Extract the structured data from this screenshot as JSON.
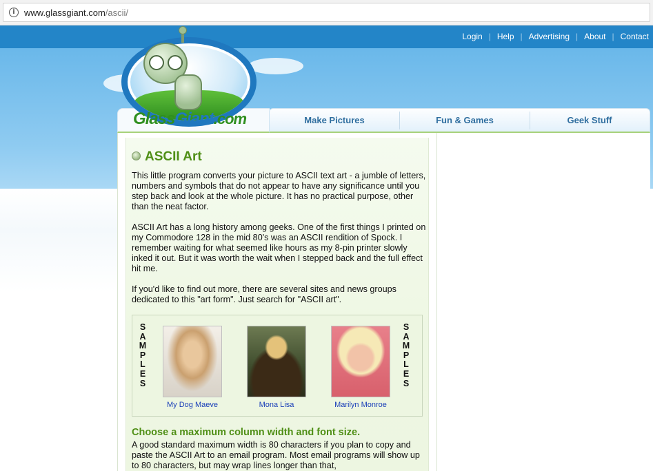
{
  "browser": {
    "url_domain": "www.glassgiant.com",
    "url_path": "/ascii/"
  },
  "top_links": [
    "Login",
    "Help",
    "Advertising",
    "About",
    "Contact"
  ],
  "logo": {
    "part1": "Glass",
    "part2": "Giant",
    "part3": ".com"
  },
  "main_nav": [
    "Make Pictures",
    "Fun & Games",
    "Geek Stuff"
  ],
  "content": {
    "title": "ASCII Art",
    "paragraphs": [
      "This little program converts your picture to ASCII text art - a jumble of letters, numbers and symbols that do not appear to have any significance until you step back and look at the whole picture. It has no practical purpose, other than the neat factor.",
      "ASCII Art has a long history among geeks. One of the first things I printed on my Commodore 128 in the mid 80's was an ASCII rendition of Spock. I remember waiting for what seemed like hours as my 8-pin printer slowly inked it out. But it was worth the wait when I stepped back and the full effect hit me.",
      "If you'd like to find out more, there are several sites and news groups dedicated to this \"art form\". Just search for \"ASCII art\"."
    ],
    "samples_vertical": "SAMPLES",
    "samples": [
      {
        "label": "My Dog Maeve"
      },
      {
        "label": "Mona Lisa"
      },
      {
        "label": "Marilyn Monroe"
      }
    ],
    "subtitle": "Choose a maximum column width and font size.",
    "paragraph_last": "A good standard maximum width is 80 characters if you plan to copy and paste the ASCII Art to an email program. Most email programs will show up to 80 characters, but may wrap lines longer than that,"
  }
}
